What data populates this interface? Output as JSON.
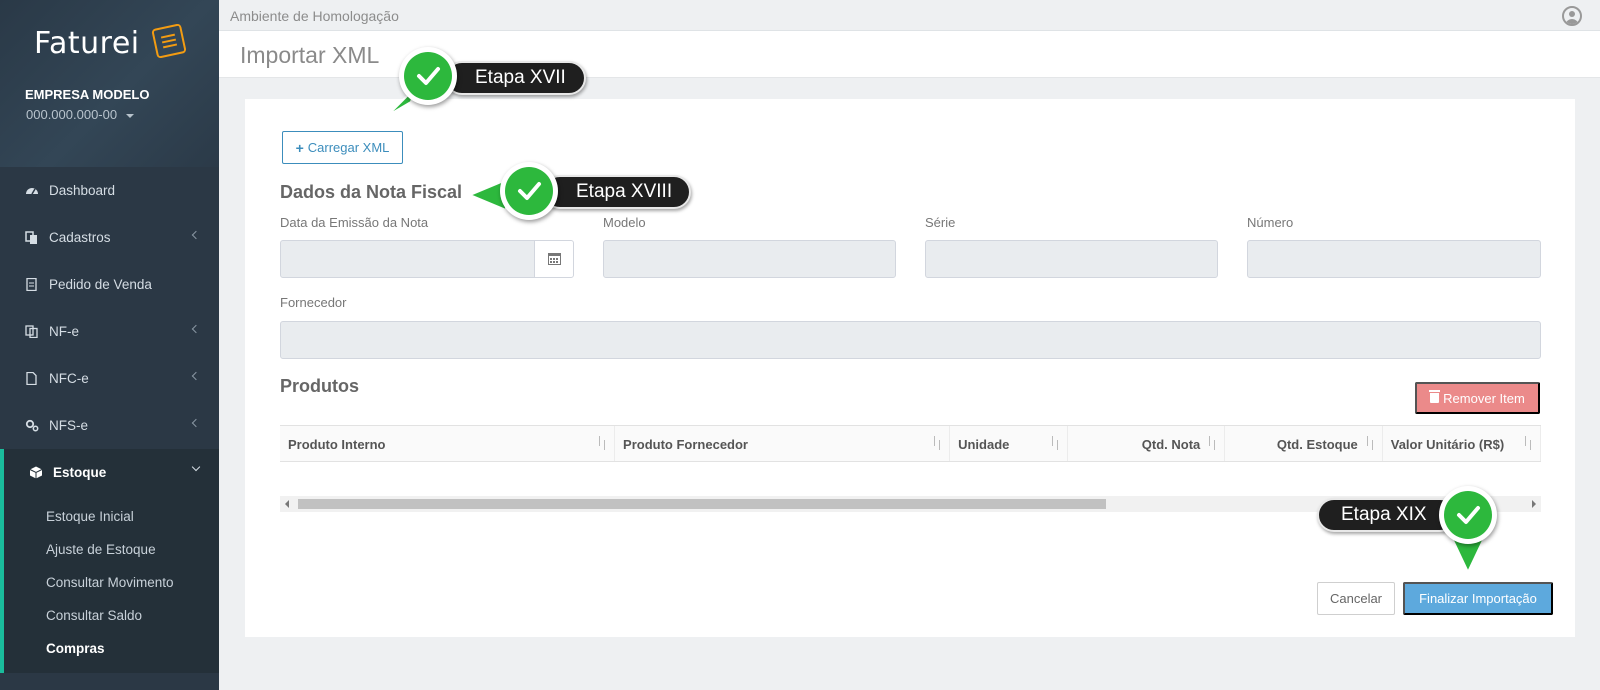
{
  "sidebar": {
    "logo": "Faturei",
    "company_name": "EMPRESA MODELO",
    "company_cnpj": "000.000.000-00",
    "menu": [
      {
        "label": "Dashboard",
        "icon": "dashboard-icon"
      },
      {
        "label": "Cadastros",
        "icon": "copy-icon"
      },
      {
        "label": "Pedido de Venda",
        "icon": "document-icon"
      },
      {
        "label": "NF-e",
        "icon": "files-icon"
      },
      {
        "label": "NFC-e",
        "icon": "file-icon"
      },
      {
        "label": "NFS-e",
        "icon": "gears-icon"
      },
      {
        "label": "Estoque",
        "icon": "cube-icon"
      }
    ],
    "submenu": [
      "Estoque Inicial",
      "Ajuste de Estoque",
      "Consultar Movimento",
      "Consultar Saldo",
      "Compras"
    ]
  },
  "topbar": {
    "environment": "Ambiente de Homologação"
  },
  "page": {
    "title": "Importar XML"
  },
  "form": {
    "load_button": "Carregar XML",
    "section_invoice": "Dados da Nota Fiscal",
    "labels": {
      "issue_date": "Data da Emissão da Nota",
      "model": "Modelo",
      "series": "Série",
      "number": "Número",
      "supplier": "Fornecedor"
    },
    "section_products": "Produtos",
    "remove_button": "Remover Item",
    "columns": [
      "Produto Interno",
      "Produto Fornecedor",
      "Unidade",
      "Qtd. Nota",
      "Qtd. Estoque",
      "Valor Unitário (R$)"
    ],
    "cancel_button": "Cancelar",
    "finish_button": "Finalizar Importação"
  },
  "callouts": {
    "step17": "Etapa XVII",
    "step18": "Etapa XVIII",
    "step19": "Etapa XIX"
  },
  "colors": {
    "sidebar_bg": "#2b3845",
    "accent_teal": "#1abc9c",
    "primary_blue": "#3c8dbc",
    "danger": "#eb8a8a",
    "badge_green": "#2db83d"
  }
}
